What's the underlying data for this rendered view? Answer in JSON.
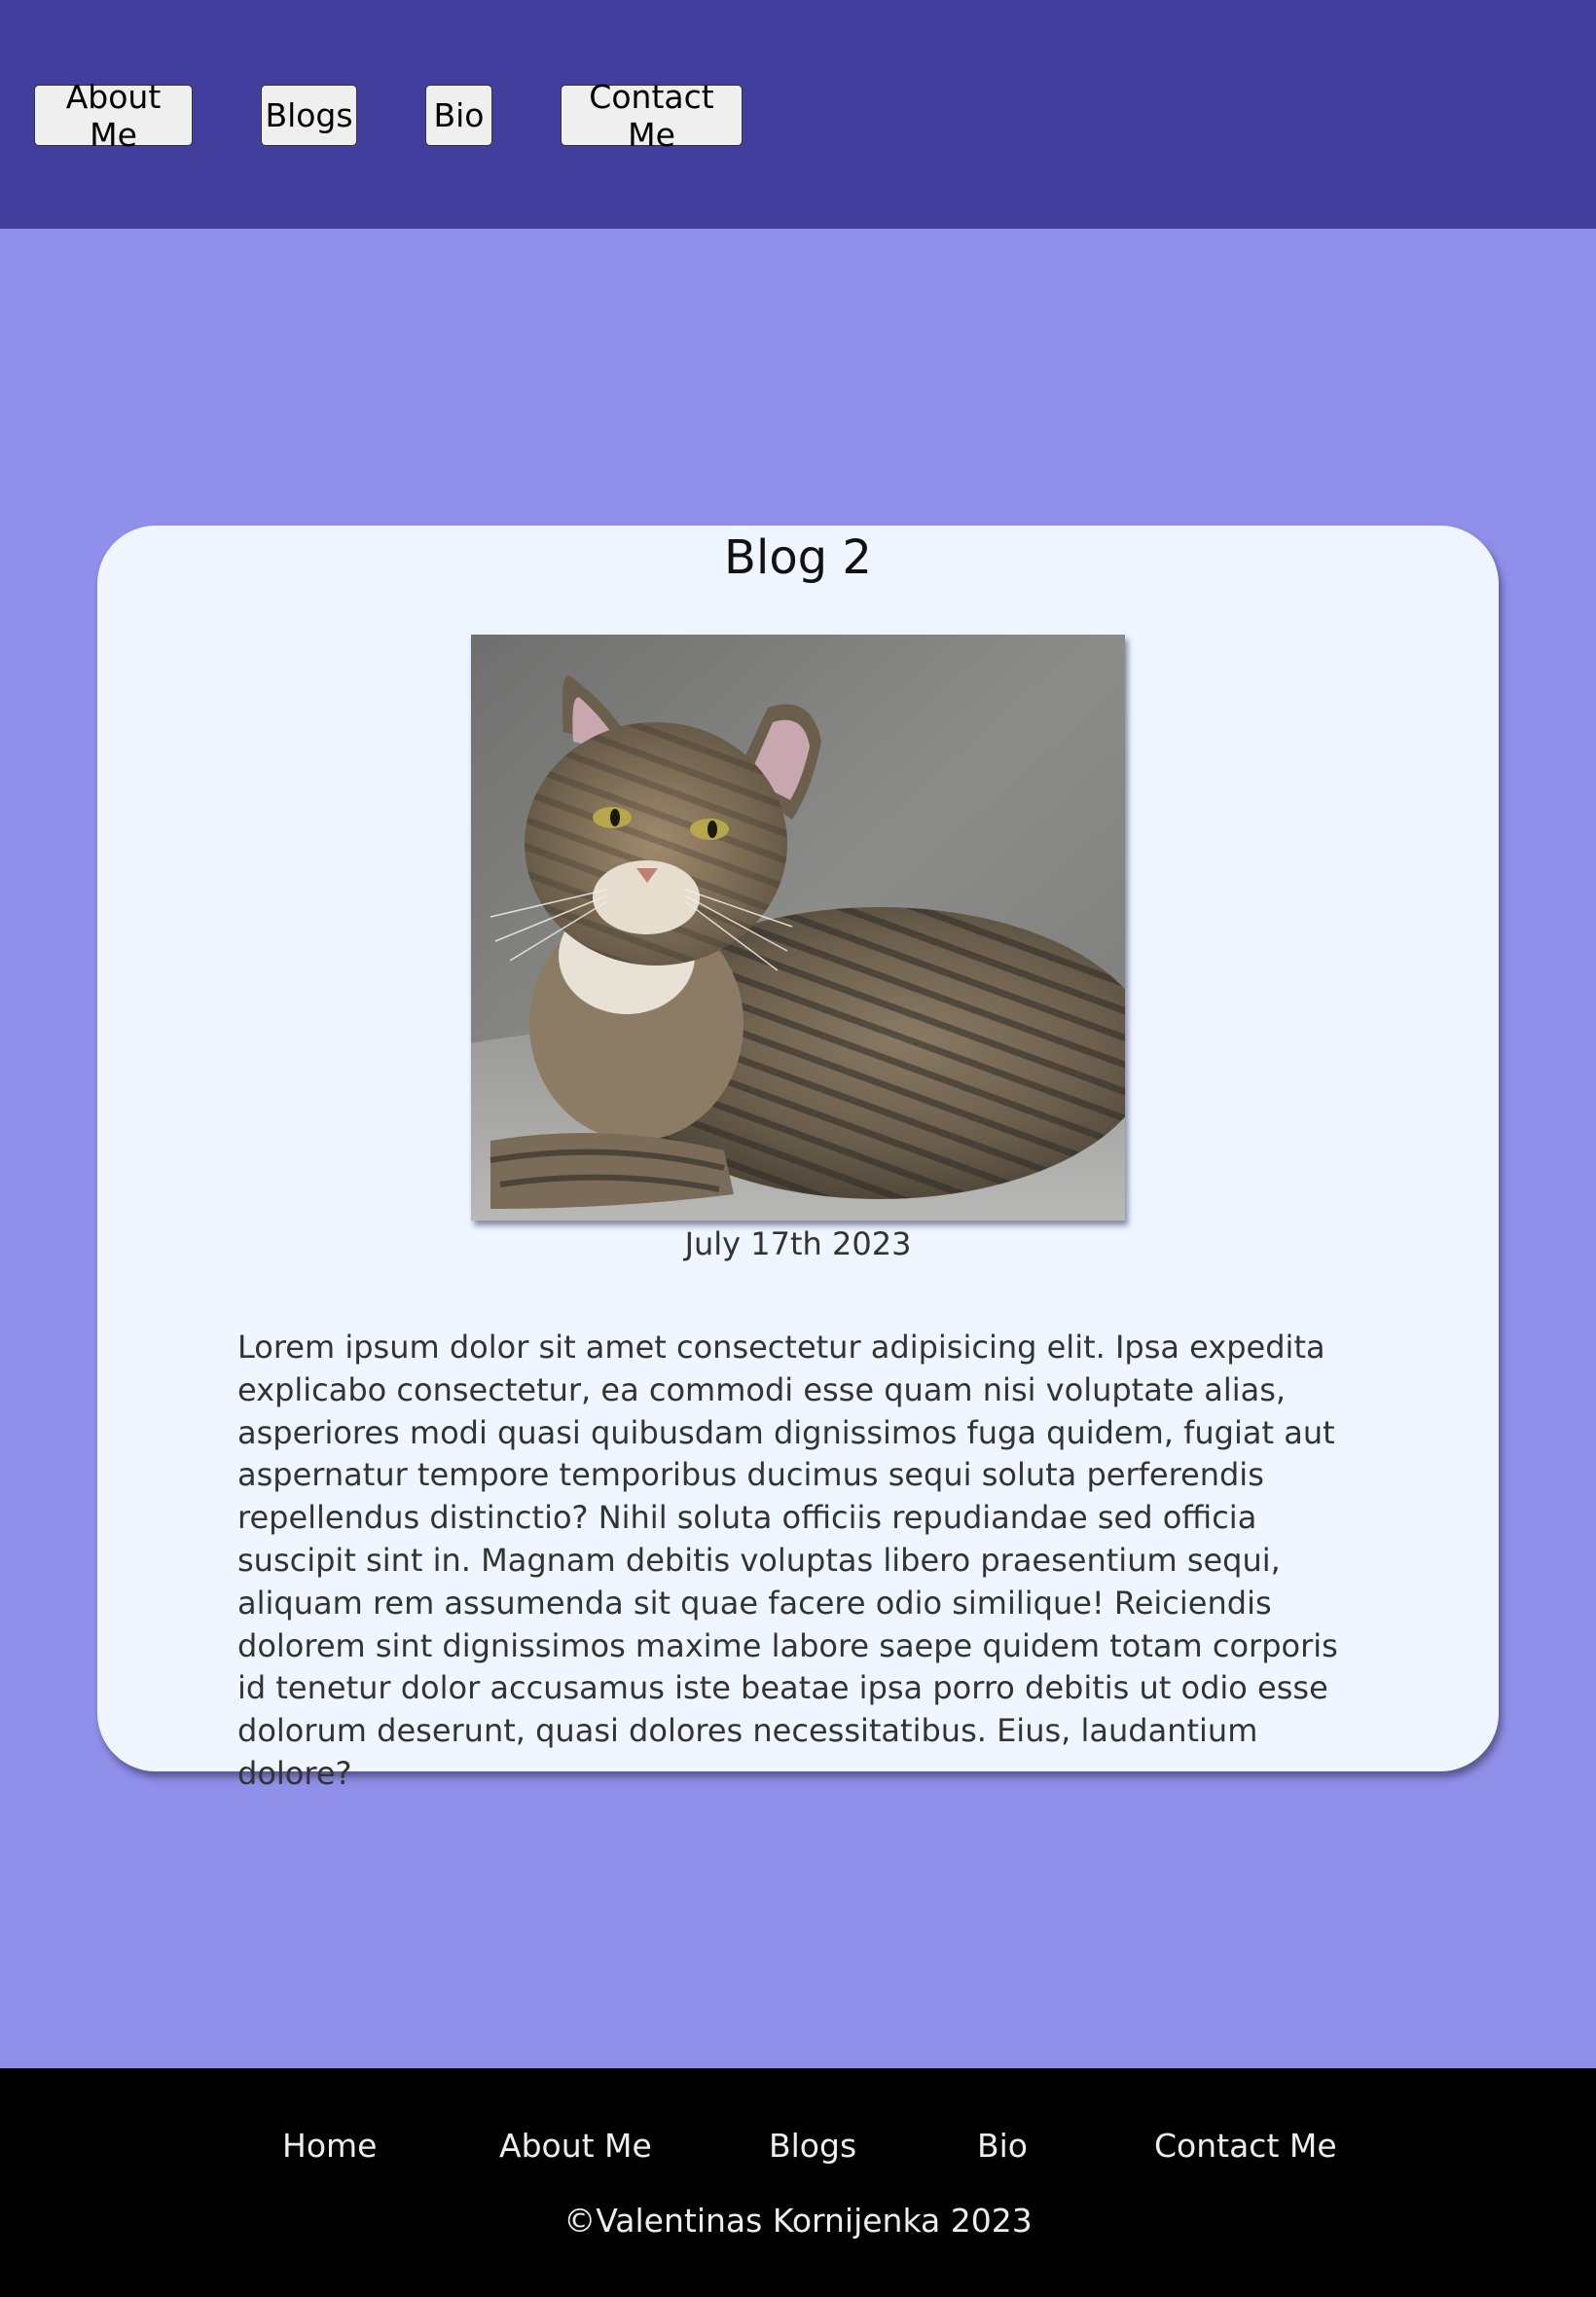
{
  "header": {
    "nav": [
      {
        "label": "About Me"
      },
      {
        "label": "Blogs"
      },
      {
        "label": "Bio"
      },
      {
        "label": "Contact Me"
      }
    ]
  },
  "blog": {
    "title": "Blog 2",
    "image_subject": "tabby-cat-photo",
    "date": "July 17th 2023",
    "body": "Lorem ipsum dolor sit amet consectetur adipisicing elit. Ipsa expedita explicabo consectetur, ea commodi esse quam nisi voluptate alias, asperiores modi quasi quibusdam dignissimos fuga quidem, fugiat aut aspernatur tempore temporibus ducimus sequi soluta perferendis repellendus distinctio? Nihil soluta officiis repudiandae sed officia suscipit sint in. Magnam debitis voluptas libero praesentium sequi, aliquam rem assumenda sit quae facere odio similique! Reiciendis dolorem sint dignissimos maxime labore saepe quidem totam corporis id tenetur dolor accusamus iste beatae ipsa porro debitis ut odio esse dolorum deserunt, quasi dolores necessitatibus. Eius, laudantium dolore?"
  },
  "footer": {
    "links": [
      {
        "label": "Home"
      },
      {
        "label": "About Me"
      },
      {
        "label": "Blogs"
      },
      {
        "label": "Bio"
      },
      {
        "label": "Contact Me"
      }
    ],
    "copyright": "©Valentinas Kornijenka 2023"
  },
  "colors": {
    "header_bg": "#423e9e",
    "page_bg": "#9090eb",
    "card_bg": "#f0f6ff",
    "footer_bg": "#000000"
  }
}
